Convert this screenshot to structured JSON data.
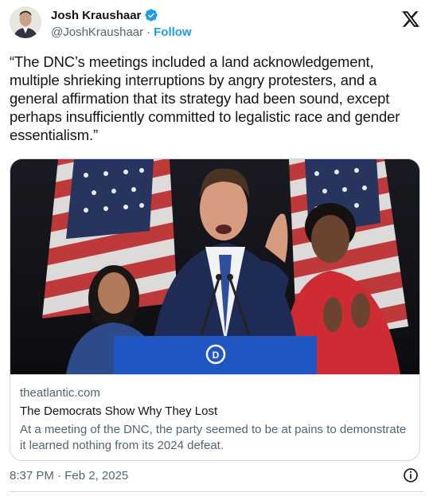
{
  "author": {
    "display_name": "Josh Kraushaar",
    "handle": "@JoshKraushaar",
    "separator": "·",
    "follow_label": "Follow",
    "verified_color": "#1d9bf0"
  },
  "tweet": {
    "text": "“The DNC’s meetings included a land acknowledgement, multiple shrieking interruptions by angry protesters, and a general affirmation that its strategy had been sound, except perhaps insufficiently committed to legalistic race and gender essentialism.”",
    "timestamp": "8:37 PM · Feb 2, 2025"
  },
  "card": {
    "domain": "theatlantic.com",
    "title": "The Democrats Show Why They Lost",
    "description": "At a meeting of the DNC, the party seemed to be at pains to demonstrate it learned nothing from its 2024 defeat.",
    "image_subject": "speaker at DNC podium with flags"
  },
  "icons": {
    "x_logo": "x-logo-icon",
    "verified": "verified-badge-icon",
    "info": "info-icon"
  },
  "colors": {
    "text_primary": "#0f1419",
    "text_secondary": "#536471",
    "link": "#1d9bf0",
    "border": "#cfd9de"
  }
}
